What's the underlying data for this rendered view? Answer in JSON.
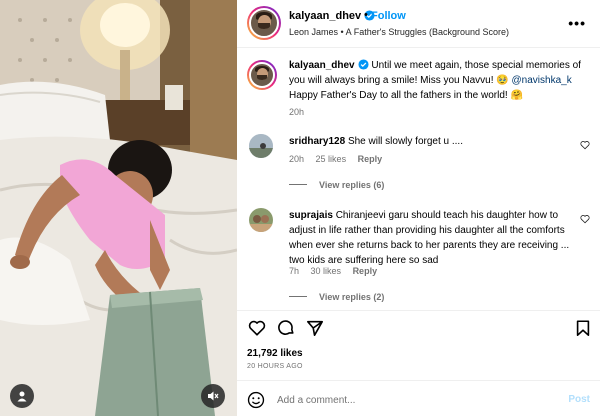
{
  "header": {
    "username": "kalyaan_dhev",
    "separator": "•",
    "follow_label": "Follow",
    "audio": "Leon James • A Father's Struggles (Background Score)",
    "more_icon": "more-options-icon"
  },
  "caption": {
    "username": "kalyaan_dhev",
    "text_part1": "Until we meet again, those special memories of you will always bring a smile! Miss you Navvu! 🥹 ",
    "mention": "@navishka_k",
    "text_part2": " Happy Father's Day to all the fathers in the world! 🤗",
    "time": "20h"
  },
  "comments": [
    {
      "username": "sridhary128",
      "text": "She will slowly forget u ....",
      "time": "20h",
      "likes": "25 likes",
      "reply_label": "Reply",
      "view_replies": "View replies (6)"
    },
    {
      "username": "suprajais",
      "text": "Chiranjeevi garu should teach his daughter how to adjust in life rather than providing his daughter all the comforts when ever she returns back to her parents they are receiving ... two kids are suffering here so sad",
      "time": "7h",
      "likes": "30 likes",
      "reply_label": "Reply",
      "view_replies": "View replies (2)"
    }
  ],
  "footer": {
    "likes": "21,792 likes",
    "posted": "20 HOURS AGO",
    "comment_placeholder": "Add a comment...",
    "post_label": "Post"
  },
  "colors": {
    "accent": "#0095f6",
    "muted": "#737373",
    "post_disabled": "#b2dffc"
  }
}
